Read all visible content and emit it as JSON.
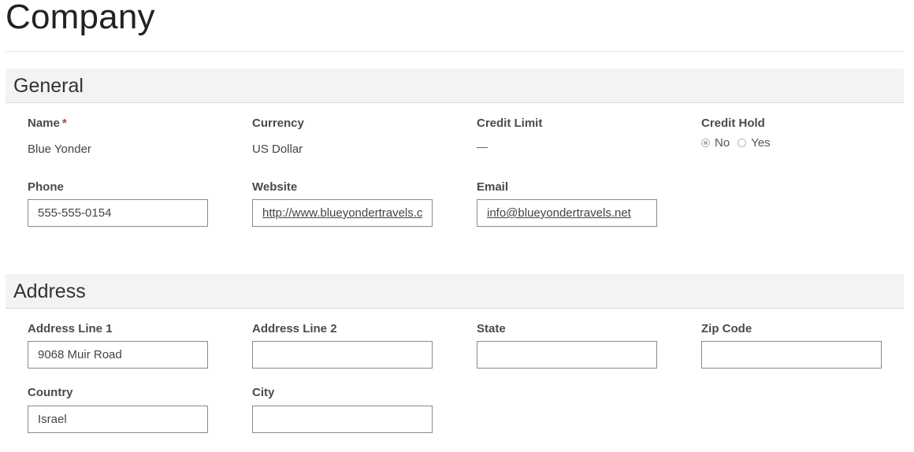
{
  "page": {
    "title": "Company"
  },
  "general": {
    "header": "General",
    "name": {
      "label": "Name",
      "required_mark": "*",
      "value": "Blue Yonder"
    },
    "currency": {
      "label": "Currency",
      "value": "US Dollar"
    },
    "credit_limit": {
      "label": "Credit Limit",
      "value": ""
    },
    "credit_hold": {
      "label": "Credit Hold",
      "options": [
        "No",
        "Yes"
      ],
      "selected": "No"
    },
    "phone": {
      "label": "Phone",
      "value": "555-555-0154"
    },
    "website": {
      "label": "Website",
      "value": "http://www.blueyondertravels.c"
    },
    "email": {
      "label": "Email",
      "value": "info@blueyondertravels.net"
    }
  },
  "address": {
    "header": "Address",
    "line1": {
      "label": "Address Line 1",
      "value": "9068 Muir Road"
    },
    "line2": {
      "label": "Address Line 2",
      "value": ""
    },
    "state": {
      "label": "State",
      "value": ""
    },
    "zip": {
      "label": "Zip Code",
      "value": ""
    },
    "country": {
      "label": "Country",
      "value": "Israel"
    },
    "city": {
      "label": "City",
      "value": ""
    }
  }
}
